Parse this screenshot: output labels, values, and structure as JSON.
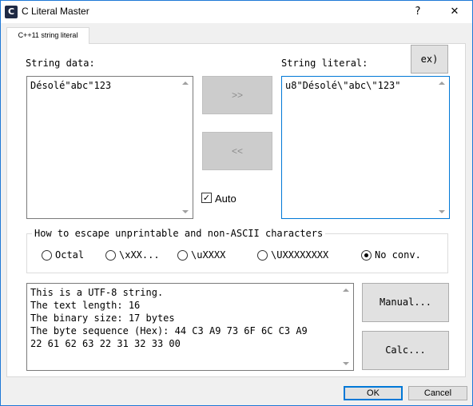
{
  "window": {
    "title": "C Literal Master",
    "help_label": "?",
    "close_label": "✕",
    "icon_text": "C"
  },
  "tab": {
    "label": "C++11 string literal"
  },
  "string_data": {
    "label": "String data:",
    "value": "Désolé\"abc\"123"
  },
  "string_literal": {
    "label": "String literal:",
    "value": "u8\"Désolé\\\"abc\\\"123\""
  },
  "buttons": {
    "example": "ex)",
    "to_literal": ">>",
    "to_data": "<<",
    "manual": "Manual...",
    "calc": "Calc...",
    "ok": "OK",
    "cancel": "Cancel"
  },
  "auto": {
    "label": "Auto",
    "checked": true,
    "mark": "✓"
  },
  "escape_group": {
    "title": "How to escape unprintable and non-ASCII characters",
    "options": [
      {
        "label": "Octal",
        "checked": false
      },
      {
        "label": "\\xXX...",
        "checked": false
      },
      {
        "label": "\\uXXXX",
        "checked": false
      },
      {
        "label": "\\UXXXXXXXX",
        "checked": false
      },
      {
        "label": "No conv.",
        "checked": true
      }
    ]
  },
  "info": {
    "lines": [
      "This is a UTF-8 string.",
      "The text length: 16",
      "The binary size: 17 bytes",
      "The byte sequence (Hex): 44 C3 A9 73 6F 6C C3 A9",
      "22 61 62 63 22 31 32 33 00"
    ]
  }
}
